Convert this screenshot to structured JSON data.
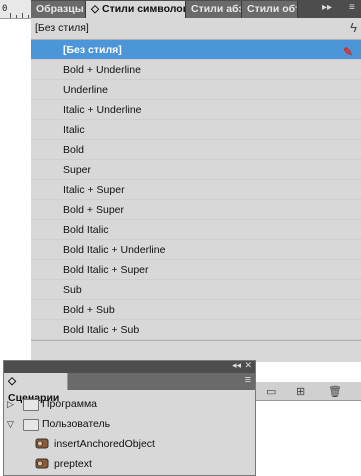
{
  "ruler": {
    "number": "0"
  },
  "char_panel": {
    "tabs": [
      {
        "label": "Образцы"
      },
      {
        "label": "◇ Стили символов"
      },
      {
        "label": "Стили абзац"
      },
      {
        "label": "Стили объ"
      }
    ],
    "tab_more": "▸▸",
    "tab_menu": "≡",
    "current_style": "[Без стиля]",
    "styles": [
      "[Без стиля]",
      "Bold + Underline",
      "Underline",
      "Italic + Underline",
      "Italic",
      "Bold",
      "Super",
      "Italic + Super",
      "Bold + Super",
      "Bold Italic",
      "Bold Italic + Underline",
      "Bold Italic + Super",
      "Sub",
      "Bold + Sub",
      "Bold Italic + Sub"
    ],
    "selected_index": 0
  },
  "scripts_panel": {
    "tab_label": "◇ Сценарии",
    "items": [
      {
        "label": "Программа",
        "kind": "folder",
        "expanded": false
      },
      {
        "label": "Пользователь",
        "kind": "folder",
        "expanded": true
      },
      {
        "label": "insertAnchoredObject",
        "kind": "script"
      },
      {
        "label": "preptext",
        "kind": "script"
      }
    ]
  },
  "colors": {
    "selection": "#4c95d8",
    "panel_bg": "#d8d8d8",
    "tab_dark": "#4d4d4d"
  }
}
